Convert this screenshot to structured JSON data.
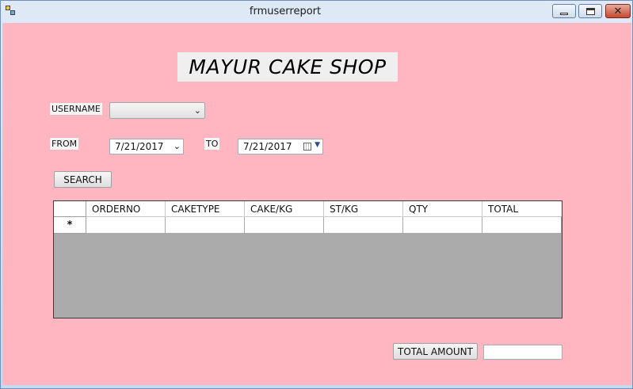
{
  "window": {
    "title": "frmuserreport"
  },
  "header": {
    "logo_text": "MAYUR CAKE SHOP"
  },
  "filters": {
    "username_label": "USERNAME",
    "username_value": "",
    "from_label": "FROM",
    "from_value": "7/21/2017",
    "to_label": "TO",
    "to_value": "7/21/2017",
    "search_label": "SEARCH"
  },
  "grid": {
    "columns": [
      "ORDERNO",
      "CAKETYPE",
      "CAKE/KG",
      "ST/KG",
      "QTY",
      "TOTAL"
    ],
    "new_row_marker": "*",
    "rows": []
  },
  "footer": {
    "total_amount_label": "TOTAL AMOUNT",
    "total_amount_value": ""
  },
  "colors": {
    "form_background": "#ffb6c1",
    "grid_background": "#ababab"
  }
}
